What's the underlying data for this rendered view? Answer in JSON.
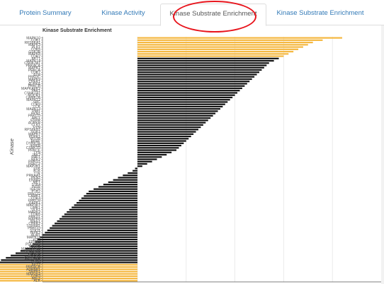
{
  "tabs": [
    {
      "label": "Protein Summary"
    },
    {
      "label": "Kinase Activity"
    },
    {
      "label": "Kinase Substrate Enrichment"
    },
    {
      "label": "Kinase Substrate Enrichment"
    }
  ],
  "colors": {
    "positive": "#f5b841",
    "negative": "#111111",
    "highlight": "#e8141c",
    "tab_link": "#337ab7"
  },
  "chart_data": {
    "type": "bar",
    "orientation": "horizontal",
    "title": "Kinase Substrate Enrichment",
    "ylabel": "Kinase",
    "xlim": [
      -4.5,
      5
    ],
    "grid": true,
    "categories": [
      "MAPK10",
      "CDK1",
      "RPS6KA1",
      "MAPK3",
      "PLK1",
      "CDK5",
      "GSK3B",
      "MAPK8",
      "CDK2",
      "AKT1",
      "MAPK14",
      "CSNK2A1",
      "PRKACA",
      "MAPK1",
      "PRKCA",
      "CDK7",
      "ATM",
      "PRKDC",
      "MAPK9",
      "CHEK1",
      "AURKA",
      "PRKCB",
      "MAPKAPK2",
      "PAK1",
      "CSNK1A1",
      "ROCK1",
      "CAMK2A",
      "MAPK12",
      "SRC",
      "CDK9",
      "LCK",
      "MAPK13",
      "PIM1",
      "PKN1",
      "PRKCD",
      "ABL1",
      "EGFR",
      "AURKB",
      "CLK1",
      "FYN",
      "RPS6KB1",
      "SGK1",
      "MAPK7",
      "PDPK1",
      "MTOR",
      "BRAF",
      "DYRK1A",
      "IKBKB",
      "CSNK1D",
      "PRKCE",
      "LYN",
      "JAK2",
      "RAF1",
      "NEK2",
      "PRKG1",
      "PRKCZ",
      "MAP2K1",
      "SYK",
      "BTK",
      "TTK",
      "PRKAA1",
      "PKN2",
      "ERBB2",
      "MET",
      "STK4",
      "INSR",
      "IGF1R",
      "PTK2",
      "PRKCG",
      "CAMK1",
      "CDK4",
      "PRKCH",
      "DAPK1",
      "MAP3K7",
      "LIMK1",
      "ULK1",
      "MARK2",
      "CDK6",
      "PRKD1",
      "MAPK6",
      "WEE1",
      "CHEK2",
      "TGFBR1",
      "PRKCQ",
      "STK11",
      "HIPK2",
      "BUB1",
      "MAPK11",
      "KDR",
      "EPHA2",
      "PDGFRB",
      "FGFR1",
      "MAPKAPK5",
      "RPS6KA3",
      "ACVR1",
      "ROCK2",
      "CSNK2A2",
      "ATR",
      "GRK2",
      "AKT2",
      "PRKACB",
      "ADRBK1",
      "SRPK1",
      "MAP2K4",
      "CDK3",
      "ABL2",
      "ALK"
    ],
    "values": [
      4.2,
      3.8,
      3.6,
      3.5,
      3.4,
      3.3,
      3.2,
      3.1,
      3.0,
      2.9,
      2.8,
      2.7,
      2.65,
      2.6,
      2.55,
      2.5,
      2.45,
      2.4,
      2.35,
      2.3,
      2.25,
      2.2,
      2.15,
      2.1,
      2.05,
      2.0,
      1.95,
      1.9,
      1.85,
      1.8,
      1.75,
      1.7,
      1.65,
      1.6,
      1.55,
      1.5,
      1.45,
      1.4,
      1.35,
      1.3,
      1.25,
      1.2,
      1.15,
      1.1,
      1.05,
      1.0,
      0.95,
      0.9,
      0.85,
      0.8,
      0.7,
      0.6,
      0.5,
      0.4,
      0.3,
      0.2,
      0.1,
      -0.05,
      -0.1,
      -0.2,
      -0.3,
      -0.4,
      -0.5,
      -0.6,
      -0.7,
      -0.8,
      -0.9,
      -1.0,
      -1.05,
      -1.1,
      -1.15,
      -1.2,
      -1.25,
      -1.3,
      -1.35,
      -1.4,
      -1.45,
      -1.5,
      -1.55,
      -1.6,
      -1.65,
      -1.7,
      -1.75,
      -1.8,
      -1.85,
      -1.9,
      -1.95,
      -2.0,
      -2.05,
      -2.1,
      -2.15,
      -2.2,
      -2.3,
      -2.4,
      -2.5,
      -2.6,
      -2.7,
      -2.8,
      -2.9,
      -3.0,
      -3.1,
      -3.2,
      -3.4,
      -3.6,
      -3.8,
      -4.0,
      -4.2
    ]
  }
}
